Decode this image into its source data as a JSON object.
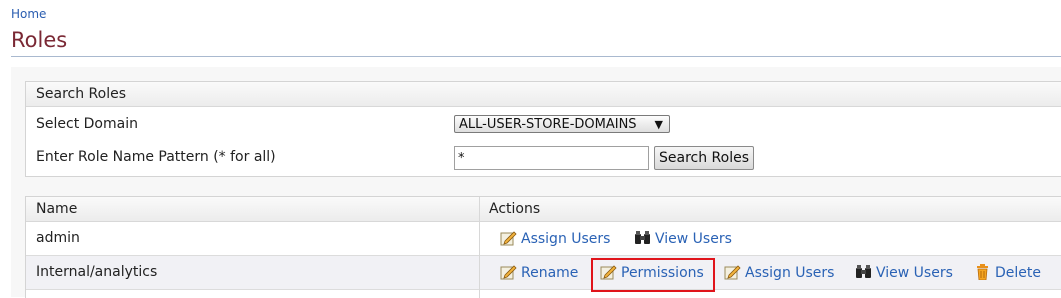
{
  "breadcrumb": "Home",
  "page_title": "Roles",
  "search": {
    "header": "Search Roles",
    "domain_label": "Select Domain",
    "domain_value": "ALL-USER-STORE-DOMAINS",
    "pattern_label": "Enter Role Name Pattern (* for all)",
    "pattern_value": "*",
    "button_label": "Search Roles"
  },
  "table": {
    "headers": {
      "name": "Name",
      "actions": "Actions"
    },
    "rows": [
      {
        "name": "admin",
        "actions": [
          "Assign Users",
          "View Users"
        ]
      },
      {
        "name": "Internal/analytics",
        "actions": [
          "Rename",
          "Permissions",
          "Assign Users",
          "View Users",
          "Delete"
        ]
      }
    ]
  },
  "icons": {
    "edit": "edit-pencil-icon",
    "view": "binoculars-icon",
    "delete": "trash-icon"
  },
  "colors": {
    "title": "#7a2834",
    "link": "#2a62b5",
    "highlight": "#e0141b"
  }
}
